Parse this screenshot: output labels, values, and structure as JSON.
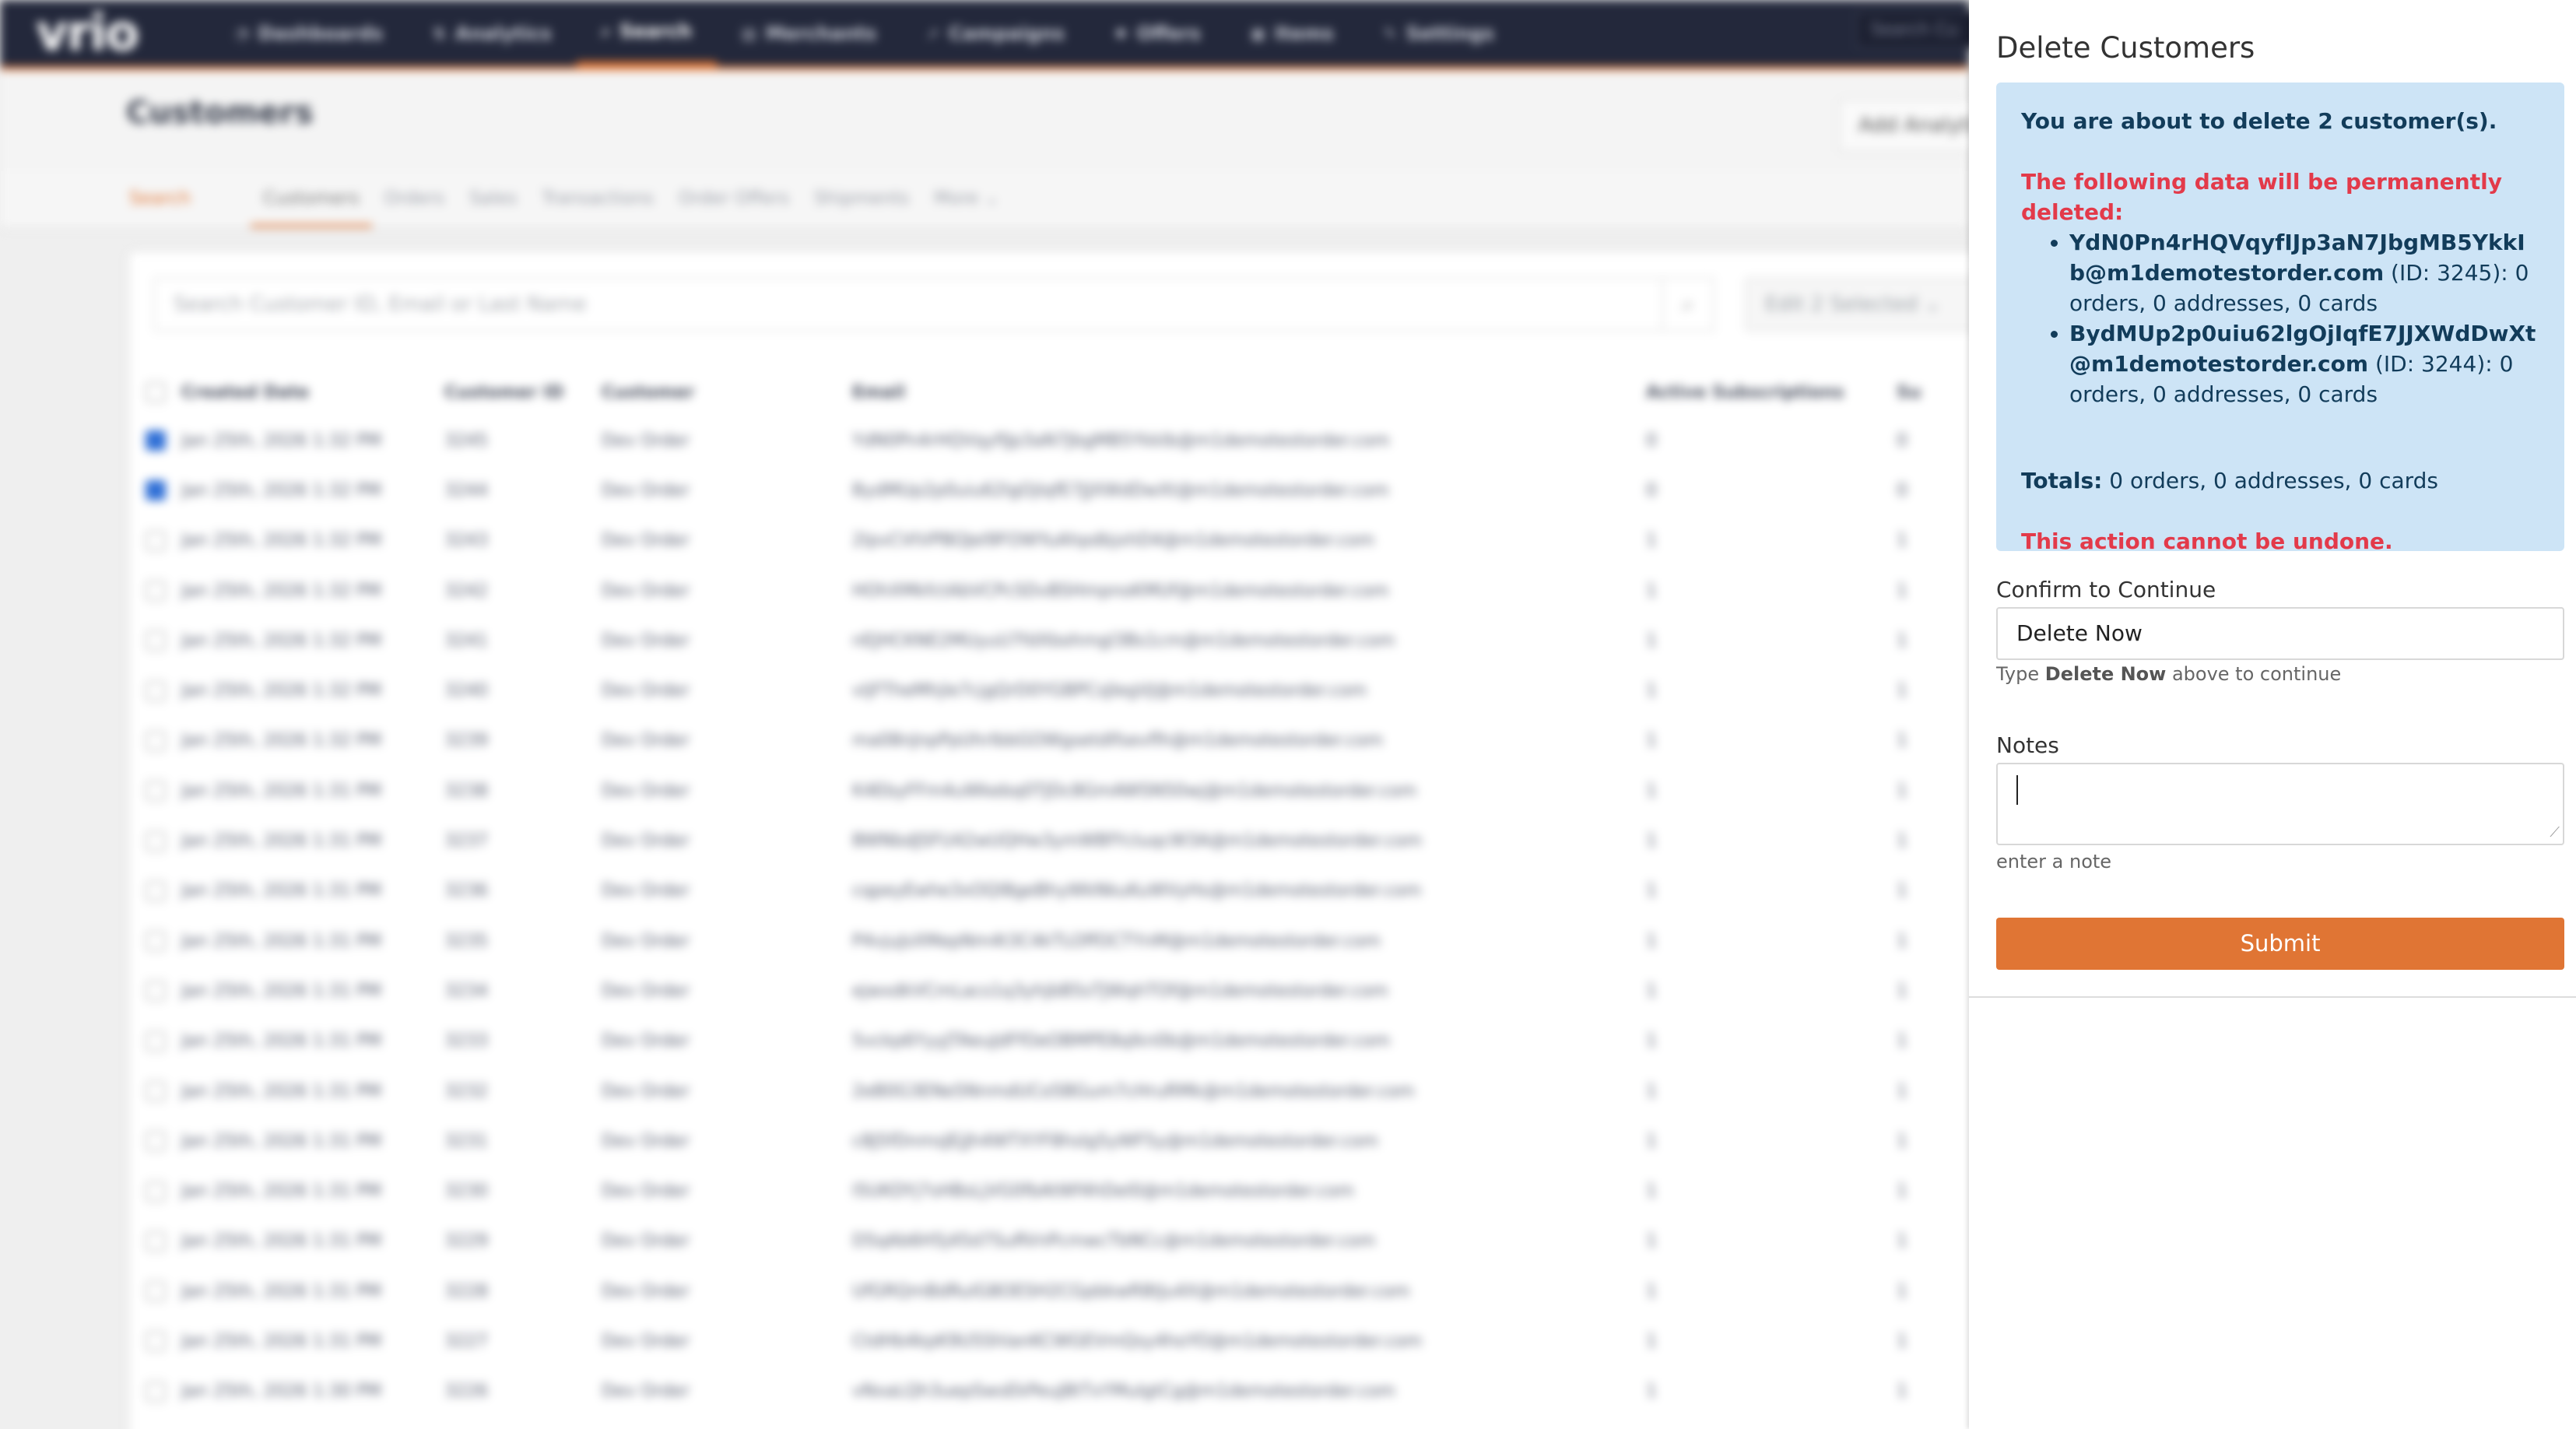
{
  "app": {
    "logo": "vrio",
    "nav": [
      {
        "icon": "◔",
        "label": "Dashboards"
      },
      {
        "icon": "⇅",
        "label": "Analytics"
      },
      {
        "icon": "⌕",
        "label": "Search"
      },
      {
        "icon": "▤",
        "label": "Merchants"
      },
      {
        "icon": "➚",
        "label": "Campaigns"
      },
      {
        "icon": "✸",
        "label": "Offers"
      },
      {
        "icon": "▣",
        "label": "Items"
      },
      {
        "icon": "✎",
        "label": "Settings"
      }
    ],
    "nav_search_placeholder": "Search Cu",
    "page_title": "Customers",
    "add_analytics_label": "Add Analyti",
    "search_tab": "Search",
    "tabs": [
      "Customers",
      "Orders",
      "Sales",
      "Transactions",
      "Order Offers",
      "Shipments",
      "More ⌄"
    ],
    "search_placeholder": "Search Customer ID, Email or Last Name",
    "search_icon": "⌕",
    "edit_selected": "Edit 2 Selected ⌄",
    "table": {
      "headers": [
        "Created Date",
        "Customer ID",
        "Customer",
        "Email",
        "Active Subscriptions",
        "Su"
      ],
      "rows": [
        {
          "checked": true,
          "date": "Jan 25th, 2026 1:32 PM",
          "id": "3245",
          "customer": "Dev Order",
          "email": "YdN0Pn4rHQVqyfIJp3aN7JbgMB5YkkIb@m1demotestorder.com",
          "subs": "0",
          "su": "0"
        },
        {
          "checked": true,
          "date": "Jan 25th, 2026 1:32 PM",
          "id": "3244",
          "customer": "Dev Order",
          "email": "BydMUp2p0uiu62lgOjIqfE7JJXWdDwXt@m1demotestorder.com",
          "subs": "0",
          "su": "0"
        },
        {
          "checked": false,
          "date": "Jan 25th, 2026 1:32 PM",
          "id": "3243",
          "customer": "Dev Order",
          "email": "2lpvCVtVPBOJeI9FOWYuAhpdbjxhD4@m1demotestorder.com",
          "subs": "1",
          "su": "1"
        },
        {
          "checked": false,
          "date": "Jan 25th, 2026 1:32 PM",
          "id": "3242",
          "customer": "Dev Order",
          "email": "HOhXMkfctAbVCPcSDvBSHmpnoKMUf@m1demotestorder.com",
          "subs": "1",
          "su": "1"
        },
        {
          "checked": false,
          "date": "Jan 25th, 2026 1:32 PM",
          "id": "3241",
          "customer": "Dev Order",
          "email": "nEJHCKNE2MUyuU7fdXbohmgl3Bs1cm@m1demotestorder.com",
          "subs": "1",
          "su": "1"
        },
        {
          "checked": false,
          "date": "Jan 25th, 2026 1:32 PM",
          "id": "3240",
          "customer": "Dev Order",
          "email": "vIjFTheMhjle7cjgQrD0YGBPCsJIegVJ@m1demotestorder.com",
          "subs": "1",
          "su": "1"
        },
        {
          "checked": false,
          "date": "Jan 25th, 2026 1:32 PM",
          "id": "3239",
          "customer": "Dev Order",
          "email": "ma08nJnpPpUhrIbbGOWgsetdlfsevflh@m1demotestorder.com",
          "subs": "1",
          "su": "1"
        },
        {
          "checked": false,
          "date": "Jan 25th, 2026 1:31 PM",
          "id": "3238",
          "customer": "Dev Order",
          "email": "K4EbyFFm4uWkebq0TJDc8GmAWSN50wj@m1demotestorder.com",
          "subs": "1",
          "su": "1"
        },
        {
          "checked": false,
          "date": "Jan 25th, 2026 1:31 PM",
          "id": "3237",
          "customer": "Dev Order",
          "email": "BWNbdJSFU42wUQHw3ymWBfYcIuqcW3A@m1demotestorder.com",
          "subs": "1",
          "su": "1"
        },
        {
          "checked": false,
          "date": "Jan 25th, 2026 1:31 PM",
          "id": "3236",
          "customer": "Dev Order",
          "email": "cqpeyEwhe3xOQl8geBhyWkNkuKuWVyHs@m1demotestorder.com",
          "subs": "1",
          "su": "1"
        },
        {
          "checked": false,
          "date": "Jan 25th, 2026 1:31 PM",
          "id": "3235",
          "customer": "Dev Order",
          "email": "P4vjuJsXMepNm4t3C4kTLOffOCTYnM@m1demotestorder.com",
          "subs": "1",
          "su": "1"
        },
        {
          "checked": false,
          "date": "Jan 25th, 2026 1:31 PM",
          "id": "3234",
          "customer": "Dev Order",
          "email": "ejwxdkVCmLacs1q3yhjbB5sTJWqhTOf@m1demotestorder.com",
          "subs": "1",
          "su": "1"
        },
        {
          "checked": false,
          "date": "Jan 25th, 2026 1:31 PM",
          "id": "3233",
          "customer": "Dev Order",
          "email": "5vckp6YyyJTAeuJdFfOeOBMPE8qlkn0b@m1demotestorder.com",
          "subs": "1",
          "su": "1"
        },
        {
          "checked": false,
          "date": "Jan 25th, 2026 1:31 PM",
          "id": "3232",
          "customer": "Dev Order",
          "email": "2eB0G3ENe5NnmdUCo5BGum7cHruRMk@m1demotestorder.com",
          "subs": "1",
          "su": "1"
        },
        {
          "checked": false,
          "date": "Jan 25th, 2026 1:31 PM",
          "id": "3231",
          "customer": "Dev Order",
          "email": "c8J5fDnmsJEjJh4WTXYF8hslg5yWF5y@m1demotestorder.com",
          "subs": "1",
          "su": "1"
        },
        {
          "checked": false,
          "date": "Jan 25th, 2026 1:31 PM",
          "id": "3230",
          "customer": "Dev Order",
          "email": "I5UKDYj7sHBsLjVG0fbAtWf4hDel0@m1demotestorder.com",
          "subs": "1",
          "su": "1"
        },
        {
          "checked": false,
          "date": "Jan 25th, 2026 1:31 PM",
          "id": "3229",
          "customer": "Dev Order",
          "email": "D5qAb6H5j45d7SuRVnPcmwcTbNCc@m1demotestorder.com",
          "subs": "1",
          "su": "1"
        },
        {
          "checked": false,
          "date": "Jan 25th, 2026 1:31 PM",
          "id": "3228",
          "customer": "Dev Order",
          "email": "UfGRQmBdRuIG8OESH2CGpbkwR8tJu4X@m1demotestorder.com",
          "subs": "1",
          "su": "1"
        },
        {
          "checked": false,
          "date": "Jan 25th, 2026 1:31 PM",
          "id": "3227",
          "customer": "Dev Order",
          "email": "CtdHb4kpK9U5ShlanKCWGEVmQsy4hoYO@m1demotestorder.com",
          "subs": "1",
          "su": "1"
        },
        {
          "checked": false,
          "date": "Jan 25th, 2026 1:30 PM",
          "id": "3226",
          "customer": "Dev Order",
          "email": "vNxaLQh3uepSwsEkPeuJ8tTxYMuIgtCg@m1demotestorder.com",
          "subs": "1",
          "su": "1"
        }
      ]
    }
  },
  "drawer": {
    "title": "Delete Customers",
    "alert": {
      "intro": "You are about to delete 2 customer(s).",
      "warning": "The following data will be permanently deleted:",
      "items": [
        {
          "email": "YdN0Pn4rHQVqyfIJp3aN7JbgMB5YkkIb@m1demotestorder.com",
          "detail": " (ID: 3245): 0 orders, 0 addresses, 0 cards"
        },
        {
          "email": "BydMUp2p0uiu62lgOjIqfE7JJXWdDwXt@m1demotestorder.com",
          "detail": " (ID: 3244): 0 orders, 0 addresses, 0 cards"
        }
      ],
      "totals_label": "Totals:",
      "totals_value": " 0 orders, 0 addresses, 0 cards",
      "undone": "This action cannot be undone."
    },
    "confirm_label": "Confirm to Continue",
    "confirm_value": "Delete Now",
    "confirm_help_prefix": "Type ",
    "confirm_help_bold": "Delete Now",
    "confirm_help_suffix": " above to continue",
    "notes_label": "Notes",
    "notes_value": "",
    "notes_help": "enter a note",
    "submit_label": "Submit",
    "colors": {
      "accent": "#e07534",
      "alert_bg": "#cde4f6",
      "danger": "#e33a4a"
    }
  }
}
